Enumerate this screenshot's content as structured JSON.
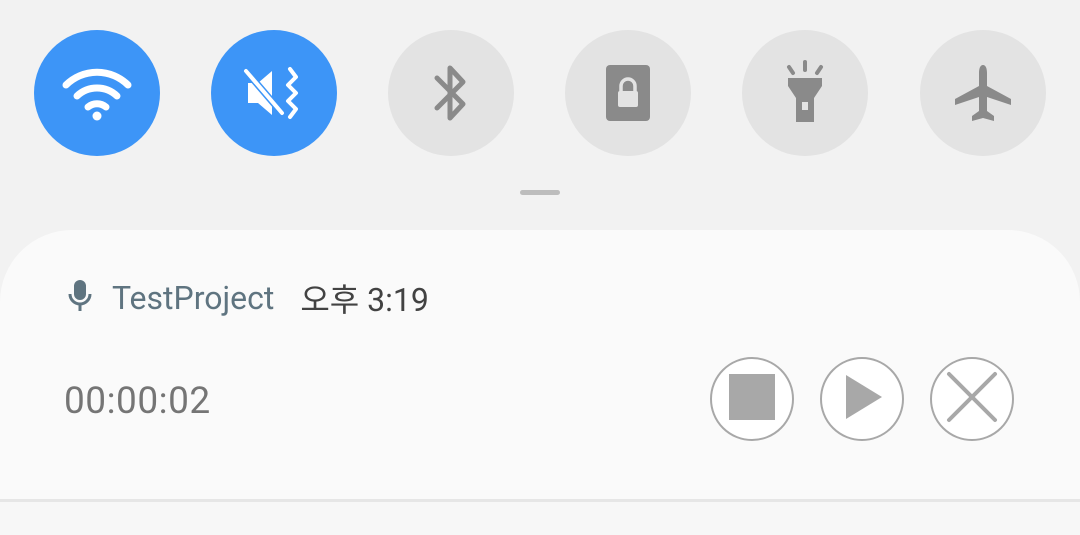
{
  "quick_settings": {
    "tiles": [
      {
        "name": "Wi-Fi",
        "icon": "wifi-icon",
        "state": "on"
      },
      {
        "name": "Mute",
        "icon": "mute-vibrate-icon",
        "state": "on"
      },
      {
        "name": "Bluetooth",
        "icon": "bluetooth-icon",
        "state": "off"
      },
      {
        "name": "Portrait lock",
        "icon": "portrait-lock-icon",
        "state": "off"
      },
      {
        "name": "Flashlight",
        "icon": "flashlight-icon",
        "state": "off"
      },
      {
        "name": "Airplane mode",
        "icon": "airplane-icon",
        "state": "off"
      }
    ],
    "colors": {
      "active": "#3d95f7",
      "inactive": "#e3e3e3",
      "icon_inactive": "#8a8a8a"
    }
  },
  "notification": {
    "app_icon": "microphone-icon",
    "app_name": "TestProject",
    "time": "오후 3:19",
    "timer": "00:00:02",
    "controls": [
      {
        "action": "stop",
        "icon": "stop-icon"
      },
      {
        "action": "play",
        "icon": "play-icon"
      },
      {
        "action": "close",
        "icon": "close-icon"
      }
    ]
  }
}
